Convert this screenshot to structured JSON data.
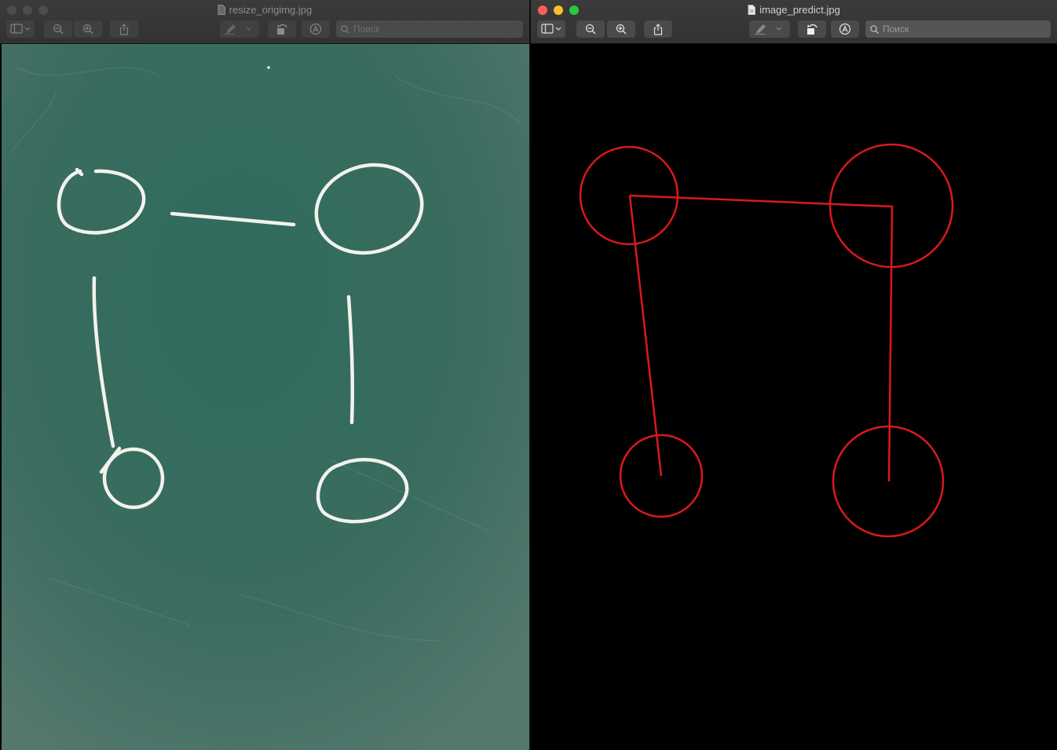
{
  "windows": [
    {
      "id": "left",
      "title": "resize_origimg.jpg",
      "focused": false,
      "search_placeholder": "Поиск",
      "content": {
        "kind": "photo",
        "description_icon": "chalkboard-photo"
      }
    },
    {
      "id": "right",
      "title": "image_predict.jpg",
      "focused": true,
      "search_placeholder": "Поиск",
      "content": {
        "kind": "rendered-prediction"
      }
    }
  ],
  "toolbar_icons": [
    "sidebar-icon",
    "zoom-out-icon",
    "zoom-in-icon",
    "share-icon",
    "markup-pen-icon",
    "rotate-icon",
    "annotate-icon",
    "search-icon"
  ],
  "colors": {
    "chalkboard": "#3b6a5c",
    "chalk": "#f2f2ec",
    "prediction_stroke": "#d9191c",
    "prediction_background": "#000000",
    "close": "#fe5f57",
    "minimize": "#febc2e",
    "maximize": "#28c840"
  }
}
